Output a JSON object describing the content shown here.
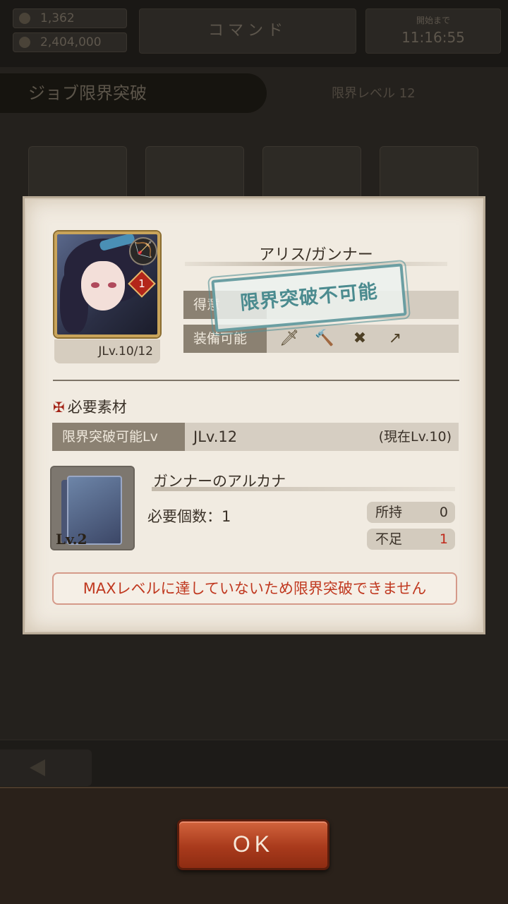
{
  "background": {
    "resource1": "1,362",
    "resource2": "2,404,000",
    "header_center": "コマンド",
    "timer_label": "開始まで",
    "timer_value": "11:16:55",
    "tab_title": "ジョブ限界突破",
    "tab_right": "限界レベル 12"
  },
  "dialog": {
    "character_name": "アリス/ガンナー",
    "jlv": "JLv.10/12",
    "rarity": "1",
    "job_icon": "bow-icon",
    "stat_rows": [
      {
        "label": "得意"
      },
      {
        "label": "装備可能"
      }
    ],
    "weapons": [
      "sword-icon",
      "hammer-icon",
      "crossbow-icon",
      "spear-icon"
    ],
    "stamp": "限界突破不可能",
    "section_title": "必要素材",
    "required_lv_label": "限界突破可能Lv",
    "required_lv_value": "JLv.12",
    "current_lv": "(現在Lv.10)",
    "arcana": {
      "card_level": "Lv.2",
      "name": "ガンナーのアルカナ",
      "need_count": "必要個数：1",
      "owned_label": "所持",
      "owned_value": "0",
      "short_label": "不足",
      "short_value": "1"
    },
    "warning": "MAXレベルに達していないため限界突破できません"
  },
  "footer": {
    "ok_label": "OK"
  },
  "colors": {
    "accent_red": "#c0281a",
    "stamp_teal": "#4b8b8f",
    "ok_button": "#b4421f"
  }
}
